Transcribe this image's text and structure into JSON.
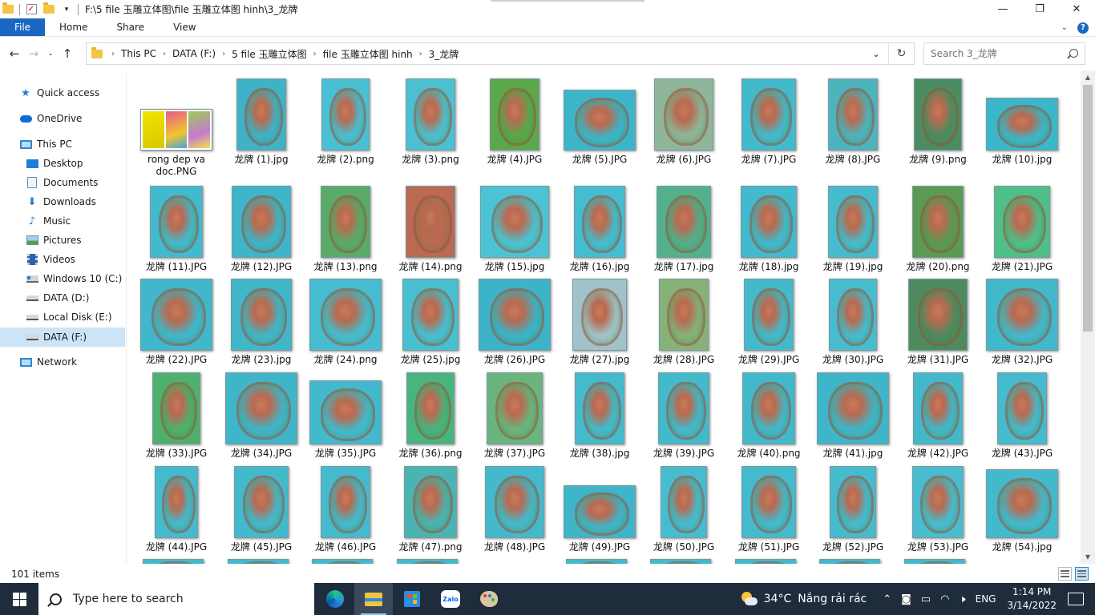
{
  "window": {
    "title": "F:\\5 file 玉雕立体图\\file 玉雕立体图 hinh\\3_龙牌",
    "controls": [
      "minimize",
      "maximize",
      "close"
    ]
  },
  "ribbon": {
    "tabs": [
      "File",
      "Home",
      "Share",
      "View"
    ]
  },
  "address": {
    "crumbs": [
      "This PC",
      "DATA (F:)",
      "5 file 玉雕立体图",
      "file 玉雕立体图 hinh",
      "3_龙牌"
    ],
    "search_placeholder": "Search 3_龙牌"
  },
  "nav": {
    "items": [
      {
        "label": "Quick access",
        "icon": "star-icon"
      },
      {
        "label": "OneDrive",
        "icon": "cloud-icon"
      },
      {
        "label": "This PC",
        "icon": "computer-icon"
      },
      {
        "label": "Desktop",
        "icon": "desktop-icon"
      },
      {
        "label": "Documents",
        "icon": "documents-icon"
      },
      {
        "label": "Downloads",
        "icon": "download-icon"
      },
      {
        "label": "Music",
        "icon": "music-icon"
      },
      {
        "label": "Pictures",
        "icon": "pictures-icon"
      },
      {
        "label": "Videos",
        "icon": "videos-icon"
      },
      {
        "label": "Windows 10 (C:)",
        "icon": "windows-drive-icon"
      },
      {
        "label": "DATA (D:)",
        "icon": "drive-icon"
      },
      {
        "label": "Local Disk (E:)",
        "icon": "drive-icon"
      },
      {
        "label": "DATA (F:)",
        "icon": "drive-icon"
      },
      {
        "label": "Network",
        "icon": "network-icon"
      }
    ],
    "selected": "DATA (F:)"
  },
  "files": [
    {
      "name": "rong dep va doc.PNG",
      "thumb": "collage"
    },
    {
      "name": "龙牌 (1).jpg",
      "thumb": "#3fb2c6"
    },
    {
      "name": "龙牌 (2).png",
      "thumb": "#49bfd3"
    },
    {
      "name": "龙牌 (3).png",
      "thumb": "#4cc0d0"
    },
    {
      "name": "龙牌 (4).JPG",
      "thumb": "#5aa84a"
    },
    {
      "name": "龙牌 (5).JPG",
      "thumb": "#3cb5c9"
    },
    {
      "name": "龙牌 (6).JPG",
      "thumb": "#8fb59a"
    },
    {
      "name": "龙牌 (7).JPG",
      "thumb": "#43b9cc"
    },
    {
      "name": "龙牌 (8).JPG",
      "thumb": "#4db4bd"
    },
    {
      "name": "龙牌 (9).png",
      "thumb": "#4c8c62"
    },
    {
      "name": "龙牌 (10).jpg",
      "thumb": "#3ab7cb"
    },
    {
      "name": "龙牌 (11).JPG",
      "thumb": "#42bacd"
    },
    {
      "name": "龙牌 (12).JPG",
      "thumb": "#3eb5c8"
    },
    {
      "name": "龙牌 (13).png",
      "thumb": "#5aab68"
    },
    {
      "name": "龙牌 (14).png",
      "thumb": "#b96a52"
    },
    {
      "name": "龙牌 (15).jpg",
      "thumb": "#4cc3d4"
    },
    {
      "name": "龙牌 (16).jpg",
      "thumb": "#44bdd0"
    },
    {
      "name": "龙牌 (17).jpg",
      "thumb": "#52b08c"
    },
    {
      "name": "龙牌 (18).jpg",
      "thumb": "#42b9cc"
    },
    {
      "name": "龙牌 (19).jpg",
      "thumb": "#46bbcd"
    },
    {
      "name": "龙牌 (20).png",
      "thumb": "#5b9a52"
    },
    {
      "name": "龙牌 (21).JPG",
      "thumb": "#4fbf8a"
    },
    {
      "name": "龙牌 (22).JPG",
      "thumb": "#40b7cb"
    },
    {
      "name": "龙牌 (23).jpg",
      "thumb": "#41b6c9"
    },
    {
      "name": "龙牌 (24).png",
      "thumb": "#45bccf"
    },
    {
      "name": "龙牌 (25).jpg",
      "thumb": "#48bfd1"
    },
    {
      "name": "龙牌 (26).JPG",
      "thumb": "#3cb3c7"
    },
    {
      "name": "龙牌 (27).jpg",
      "thumb": "#9fc3c9"
    },
    {
      "name": "龙牌 (28).JPG",
      "thumb": "#86b27a"
    },
    {
      "name": "龙牌 (29).JPG",
      "thumb": "#44b9cc"
    },
    {
      "name": "龙牌 (30).JPG",
      "thumb": "#47bccf"
    },
    {
      "name": "龙牌 (31).JPG",
      "thumb": "#4e8a5e"
    },
    {
      "name": "龙牌 (32).JPG",
      "thumb": "#42b8cb"
    },
    {
      "name": "龙牌 (33).JPG",
      "thumb": "#4fb06c"
    },
    {
      "name": "龙牌 (34).JPG",
      "thumb": "#3fb5c9"
    },
    {
      "name": "龙牌 (35).JPG",
      "thumb": "#42b9cc"
    },
    {
      "name": "龙牌 (36).png",
      "thumb": "#48b57e"
    },
    {
      "name": "龙牌 (37).JPG",
      "thumb": "#6ab57e"
    },
    {
      "name": "龙牌 (38).jpg",
      "thumb": "#44bacd"
    },
    {
      "name": "龙牌 (39).JPG",
      "thumb": "#43b9cc"
    },
    {
      "name": "龙牌 (40).png",
      "thumb": "#42b8cb"
    },
    {
      "name": "龙牌 (41).jpg",
      "thumb": "#3fb5c9"
    },
    {
      "name": "龙牌 (42).JPG",
      "thumb": "#43b8ca"
    },
    {
      "name": "龙牌 (43).JPG",
      "thumb": "#45bbcd"
    },
    {
      "name": "龙牌 (44).JPG",
      "thumb": "#44bacd"
    },
    {
      "name": "龙牌 (45).JPG",
      "thumb": "#43b9cc"
    },
    {
      "name": "龙牌 (46).JPG",
      "thumb": "#45bacd"
    },
    {
      "name": "龙牌 (47).png",
      "thumb": "#4ab4b0"
    },
    {
      "name": "龙牌 (48).JPG",
      "thumb": "#44b9cc"
    },
    {
      "name": "龙牌 (49).JPG",
      "thumb": "#3fb5c9"
    },
    {
      "name": "龙牌 (50).JPG",
      "thumb": "#46bccf"
    },
    {
      "name": "龙牌 (51).JPG",
      "thumb": "#44bacd"
    },
    {
      "name": "龙牌 (52).JPG",
      "thumb": "#45bbcd"
    },
    {
      "name": "龙牌 (53).JPG",
      "thumb": "#48bdcf"
    },
    {
      "name": "龙牌 (54).jpg",
      "thumb": "#43b9cc"
    }
  ],
  "status": {
    "item_count": "101 items"
  },
  "taskbar": {
    "search_placeholder": "Type here to search",
    "apps": [
      "edge-icon",
      "file-explorer-icon",
      "store-icon",
      "zalo-icon",
      "paint-icon"
    ],
    "zalo_label": "Zalo",
    "weather_temp": "34°C",
    "weather_text": "Nắng rải rác",
    "language": "ENG",
    "time": "1:14 PM",
    "date": "3/14/2022"
  }
}
